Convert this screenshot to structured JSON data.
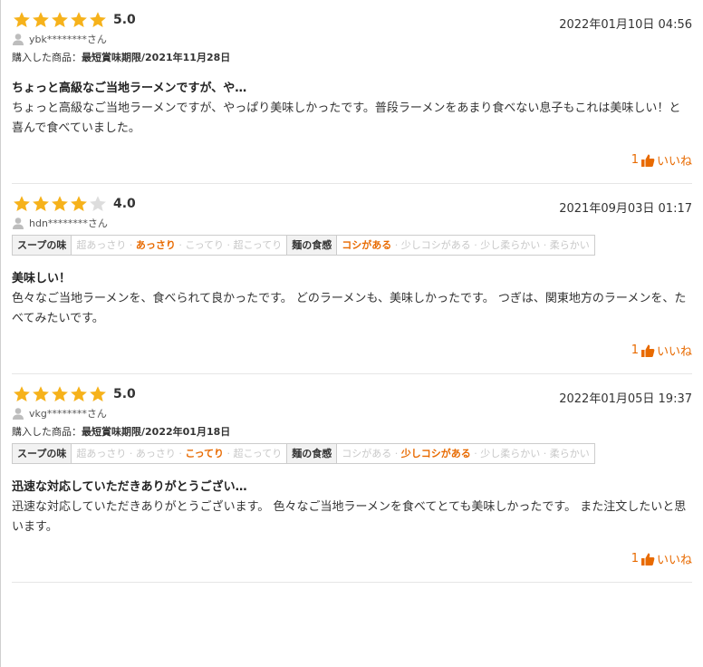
{
  "colors": {
    "accent": "#e86a00",
    "star_on": "#f6b21b",
    "star_off": "#dddddd"
  },
  "reviews": [
    {
      "rating": 5,
      "score": "5.0",
      "date": "2022年01月10日 04:56",
      "user": "ybk********さん",
      "purchase_label": "購入した商品：",
      "purchase_item": "最短賞味期限/2021年11月28日",
      "title": "ちょっと高級なご当地ラーメンですが、や…",
      "body": "ちょっと高級なご当地ラーメンですが、やっぱり美味しかったです。普段ラーメンをあまり食べない息子もこれは美味しい！と喜んで食べていました。",
      "like_count": "1",
      "like_label": "いいね"
    },
    {
      "rating": 4,
      "score": "4.0",
      "date": "2021年09月03日 01:17",
      "user": "hdn********さん",
      "attrs": {
        "soup_label": "スープの味",
        "soup": [
          "超あっさり",
          "あっさり",
          "こってり",
          "超こってり"
        ],
        "soup_selected": "あっさり",
        "noodle_label": "麺の食感",
        "noodle": [
          "コシがある",
          "少しコシがある",
          "少し柔らかい",
          "柔らかい"
        ],
        "noodle_selected": "コシがある"
      },
      "title": "美味しい！",
      "body": "色々なご当地ラーメンを、食べられて良かったです。 どのラーメンも、美味しかったです。 つぎは、関東地方のラーメンを、たべてみたいです。",
      "like_count": "1",
      "like_label": "いいね"
    },
    {
      "rating": 5,
      "score": "5.0",
      "date": "2022年01月05日 19:37",
      "user": "vkg********さん",
      "purchase_label": "購入した商品：",
      "purchase_item": "最短賞味期限/2022年01月18日",
      "attrs": {
        "soup_label": "スープの味",
        "soup": [
          "超あっさり",
          "あっさり",
          "こってり",
          "超こってり"
        ],
        "soup_selected": "こってり",
        "noodle_label": "麺の食感",
        "noodle": [
          "コシがある",
          "少しコシがある",
          "少し柔らかい",
          "柔らかい"
        ],
        "noodle_selected": "少しコシがある"
      },
      "title": "迅速な対応していただきありがとうござい…",
      "body": "迅速な対応していただきありがとうございます。 色々なご当地ラーメンを食べてとても美味しかったです。 また注文したいと思います。",
      "like_count": "1",
      "like_label": "いいね"
    }
  ]
}
